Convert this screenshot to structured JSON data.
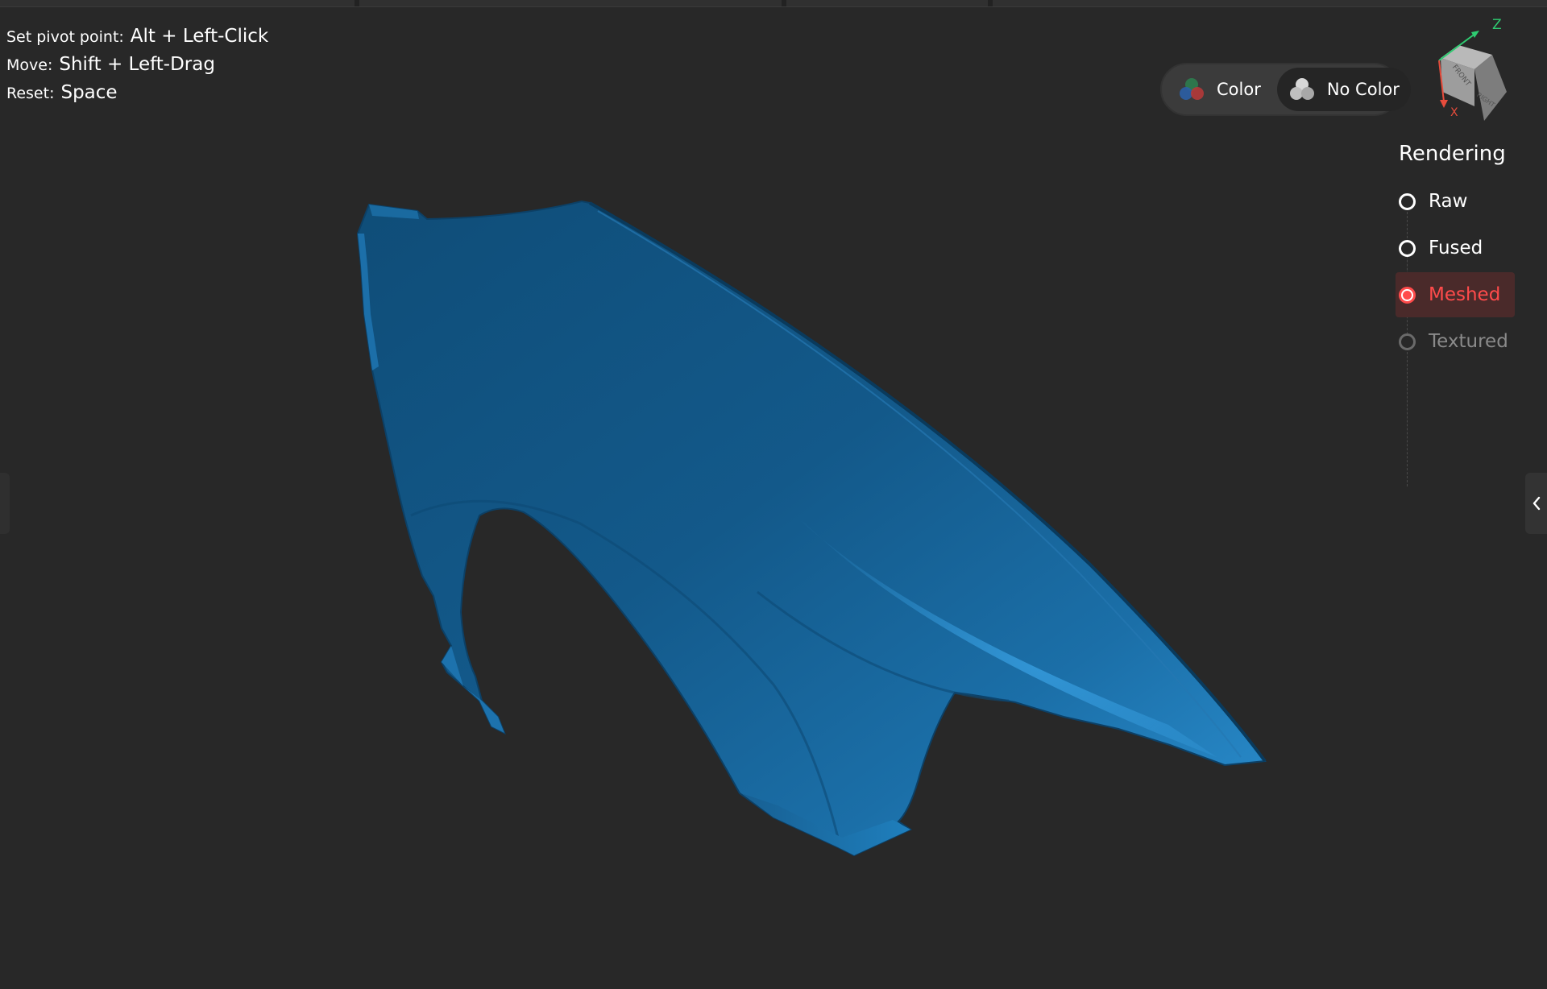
{
  "hints": [
    {
      "label": "Set pivot point:",
      "value": "Alt + Left-Click"
    },
    {
      "label": "Move:",
      "value": "Shift + Left-Drag"
    },
    {
      "label": "Reset:",
      "value": "Space"
    }
  ],
  "color_toggle": {
    "color_label": "Color",
    "no_color_label": "No Color",
    "selected": "No Color"
  },
  "view_cube": {
    "face_front": "FRONT",
    "face_right": "RIGHT",
    "axis_z": "Z",
    "axis_x": "X",
    "axis_z_color": "#2ecc71",
    "axis_x_color": "#e74c3c"
  },
  "rendering": {
    "title": "Rendering",
    "options": [
      {
        "label": "Raw",
        "state": "unselected"
      },
      {
        "label": "Fused",
        "state": "unselected"
      },
      {
        "label": "Meshed",
        "state": "selected"
      },
      {
        "label": "Textured",
        "state": "disabled"
      }
    ]
  },
  "icons": {
    "right_tab": "chevron-left-icon"
  },
  "colors": {
    "background": "#282828",
    "accent": "#ff4b4b",
    "model": "#1a6aa0"
  }
}
